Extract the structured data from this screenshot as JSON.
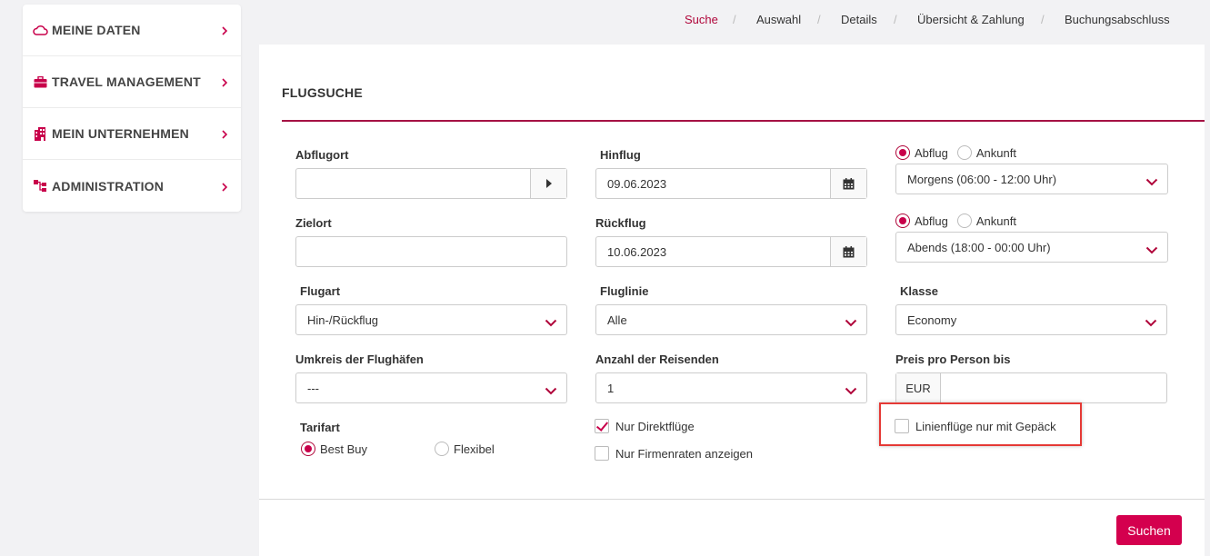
{
  "sidebar": {
    "items": [
      {
        "label": "MEINE DATEN",
        "icon": "cloud-icon"
      },
      {
        "label": "TRAVEL MANAGEMENT",
        "icon": "briefcase-icon"
      },
      {
        "label": "MEIN UNTERNEHMEN",
        "icon": "building-icon"
      },
      {
        "label": "ADMINISTRATION",
        "icon": "sitemap-icon"
      }
    ]
  },
  "breadcrumb": {
    "steps": [
      "Suche",
      "Auswahl",
      "Details",
      "Übersicht & Zahlung",
      "Buchungsabschluss"
    ],
    "active": "Suche",
    "separator": "/"
  },
  "form": {
    "title": "FLUGSUCHE",
    "departure": {
      "label": "Abflugort",
      "value": ""
    },
    "destination": {
      "label": "Zielort",
      "value": ""
    },
    "outbound": {
      "label": "Hinflug",
      "date": "09.06.2023"
    },
    "return": {
      "label": "Rückflug",
      "date": "10.06.2023"
    },
    "outbound_time": {
      "opt_departure": "Abflug",
      "opt_arrival": "Ankunft",
      "selected": "Abflug",
      "value": "Morgens (06:00 - 12:00 Uhr)"
    },
    "return_time": {
      "opt_departure": "Abflug",
      "opt_arrival": "Ankunft",
      "selected": "Abflug",
      "value": "Abends (18:00 - 00:00 Uhr)"
    },
    "flight_type": {
      "label": "Flugart",
      "value": "Hin-/Rückflug"
    },
    "airline": {
      "label": "Fluglinie",
      "value": "Alle"
    },
    "class": {
      "label": "Klasse",
      "value": "Economy"
    },
    "radius": {
      "label": "Umkreis der Flughäfen",
      "value": "---"
    },
    "travelers": {
      "label": "Anzahl der Reisenden",
      "value": "1"
    },
    "max_price": {
      "label": "Preis pro Person bis",
      "currency": "EUR",
      "value": ""
    },
    "fare_type": {
      "label": "Tarifart",
      "opt_best_buy": "Best Buy",
      "opt_flexible": "Flexibel",
      "selected": "Best Buy"
    },
    "direct_only": {
      "label": "Nur Direktflüge",
      "checked": true
    },
    "company_rates": {
      "label": "Nur Firmenraten anzeigen",
      "checked": false
    },
    "baggage_only": {
      "label": "Linienflüge nur mit Gepäck",
      "checked": false
    },
    "submit_label": "Suchen"
  },
  "colors": {
    "accent": "#c8004a",
    "rule": "#a51244",
    "highlight": "#e53935"
  }
}
